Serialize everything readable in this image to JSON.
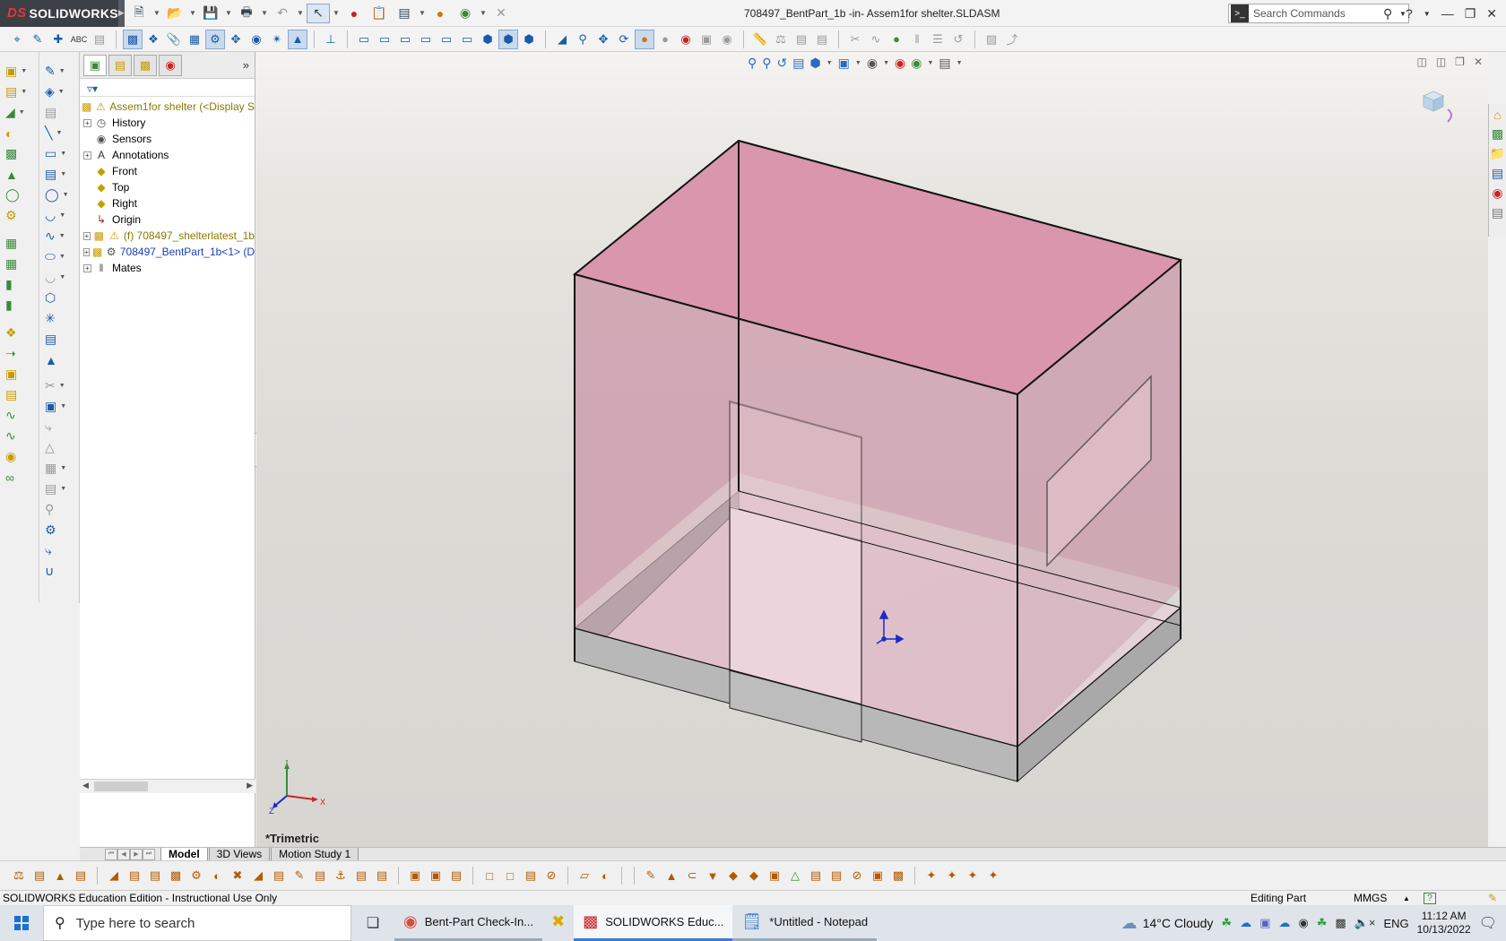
{
  "app": {
    "brand": "SOLIDWORKS",
    "doc_title": "708497_BentPart_1b -in- Assem1for shelter.SLDASM",
    "search_placeholder": "Search Commands"
  },
  "feature_tree": {
    "root": "Assem1for shelter  (<Display S",
    "items": [
      {
        "label": "History",
        "icon": "history-icon",
        "expand": true,
        "style": "normal"
      },
      {
        "label": "Sensors",
        "icon": "sensors-icon",
        "expand": false,
        "style": "normal"
      },
      {
        "label": "Annotations",
        "icon": "annotations-icon",
        "expand": true,
        "style": "normal"
      },
      {
        "label": "Front",
        "icon": "plane-icon",
        "expand": false,
        "style": "normal"
      },
      {
        "label": "Top",
        "icon": "plane-icon",
        "expand": false,
        "style": "normal"
      },
      {
        "label": "Right",
        "icon": "plane-icon",
        "expand": false,
        "style": "normal"
      },
      {
        "label": "Origin",
        "icon": "origin-icon",
        "expand": false,
        "style": "normal"
      },
      {
        "label": "(f) 708497_shelterlatest_1b",
        "icon": "part-warning-icon",
        "expand": true,
        "style": "warn"
      },
      {
        "label": "708497_BentPart_1b<1> (D",
        "icon": "part-edit-icon",
        "expand": true,
        "style": "link"
      },
      {
        "label": "Mates",
        "icon": "mates-icon",
        "expand": true,
        "style": "normal"
      }
    ]
  },
  "graphics": {
    "view_label": "*Trimetric",
    "triad_x": "X",
    "triad_y": "Y",
    "triad_z": "Z"
  },
  "bottom_tabs": [
    "Model",
    "3D Views",
    "Motion Study 1"
  ],
  "status": {
    "edition": "SOLIDWORKS Education Edition - Instructional Use Only",
    "mode": "Editing Part",
    "units": "MMGS",
    "help": "?"
  },
  "taskbar": {
    "search_placeholder": "Type here to search",
    "apps": [
      {
        "label": "Bent-Part Check-In...",
        "icon": "chrome-icon",
        "state": "running"
      },
      {
        "label": "",
        "icon": "xming-icon",
        "state": "normal"
      },
      {
        "label": "SOLIDWORKS Educ...",
        "icon": "solidworks-icon",
        "state": "active"
      },
      {
        "label": "*Untitled - Notepad",
        "icon": "notepad-icon",
        "state": "running"
      }
    ],
    "weather": "14°C  Cloudy",
    "language": "ENG",
    "time": "11:12 AM",
    "date": "10/13/2022"
  },
  "colors": {
    "shell_pink": "#d08aa0",
    "plate_grey": "#c9c9c9",
    "accent_blue": "#1a5aa8"
  }
}
